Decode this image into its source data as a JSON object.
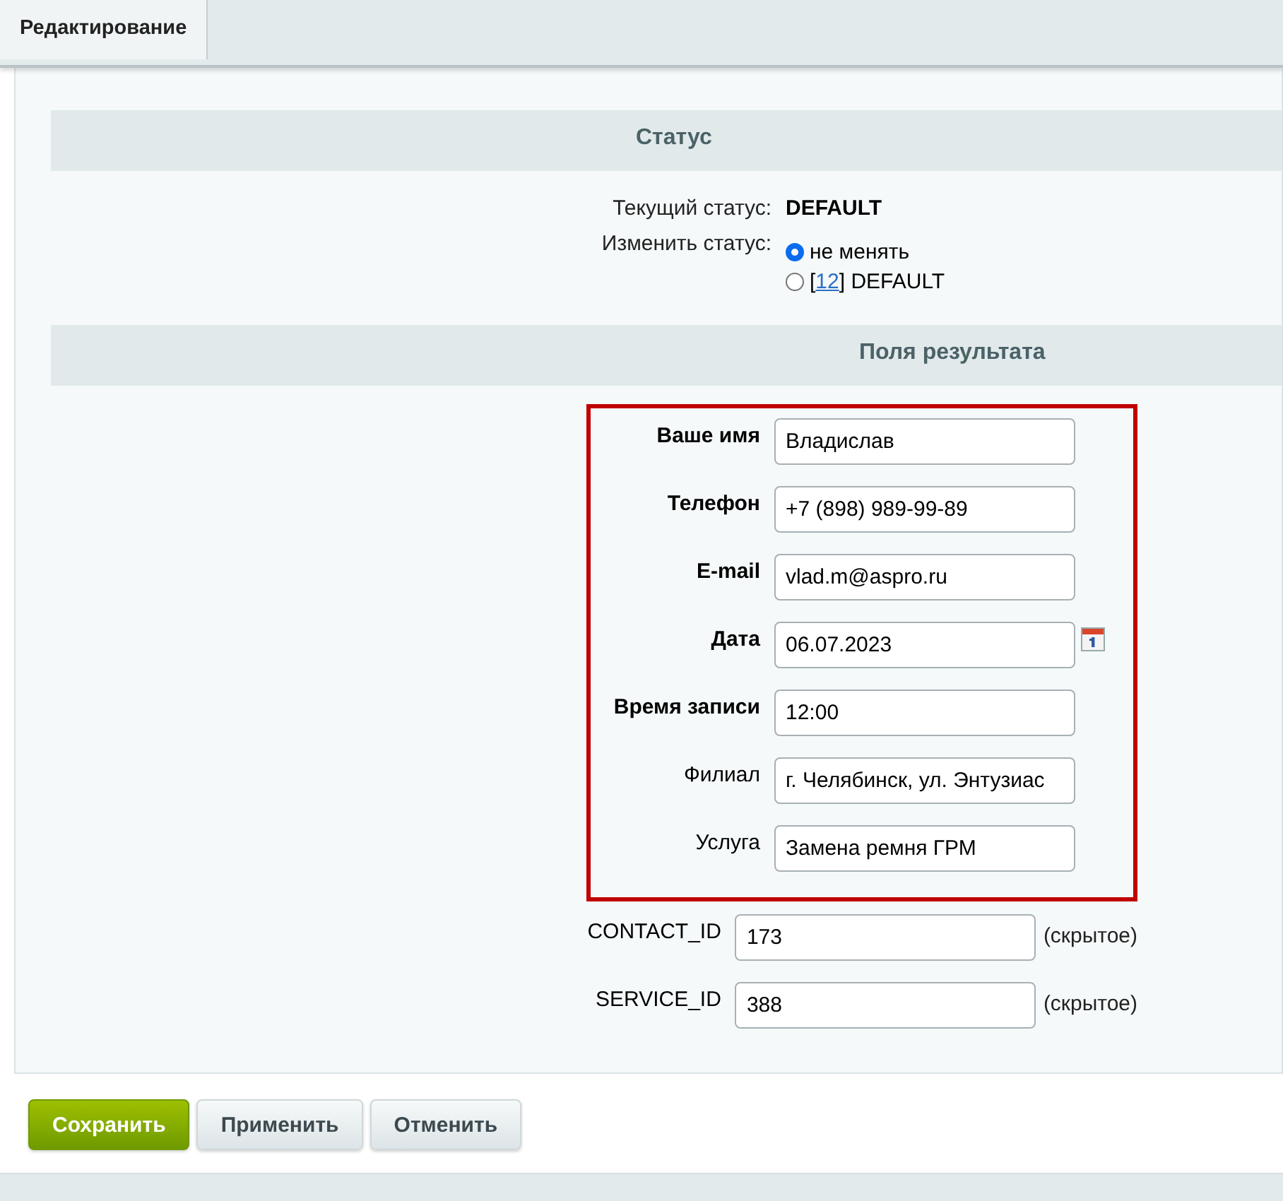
{
  "tabs": [
    {
      "label": "Редактирование",
      "selected": true
    }
  ],
  "status_section": {
    "title": "Статус",
    "current_label": "Текущий статус:",
    "current_value": "DEFAULT",
    "change_label": "Изменить статус:",
    "options": [
      {
        "label": "не менять",
        "selected": true
      },
      {
        "prefix": "[",
        "link": "12",
        "suffix": "] DEFAULT",
        "selected": false
      }
    ]
  },
  "result_section": {
    "title": "Поля результата",
    "fields": [
      {
        "label": "Ваше имя",
        "value": "Владислав",
        "required": true,
        "highlighted": true,
        "kind": "text"
      },
      {
        "label": "Телефон",
        "value": "+7 (898) 989-99-89",
        "required": true,
        "highlighted": true,
        "kind": "text"
      },
      {
        "label": "E-mail",
        "value": "vlad.m@aspro.ru",
        "required": true,
        "highlighted": true,
        "kind": "text"
      },
      {
        "label": "Дата",
        "value": "06.07.2023",
        "required": true,
        "highlighted": true,
        "kind": "date"
      },
      {
        "label": "Время записи",
        "value": "12:00",
        "required": true,
        "highlighted": true,
        "kind": "text"
      },
      {
        "label": "Филиал",
        "value": "г. Челябинск, ул. Энтузиас",
        "required": false,
        "highlighted": true,
        "kind": "text"
      },
      {
        "label": "Услуга",
        "value": "Замена ремня ГРМ",
        "required": false,
        "highlighted": true,
        "kind": "text"
      },
      {
        "label": "CONTACT_ID",
        "value": "173",
        "required": false,
        "highlighted": false,
        "kind": "text",
        "note": "(скрытое)"
      },
      {
        "label": "SERVICE_ID",
        "value": "388",
        "required": false,
        "highlighted": false,
        "kind": "text",
        "note": "(скрытое)"
      }
    ]
  },
  "buttons": [
    {
      "label": "Сохранить",
      "kind": "primary"
    },
    {
      "label": "Применить",
      "kind": "default"
    },
    {
      "label": "Отменить",
      "kind": "default"
    }
  ]
}
